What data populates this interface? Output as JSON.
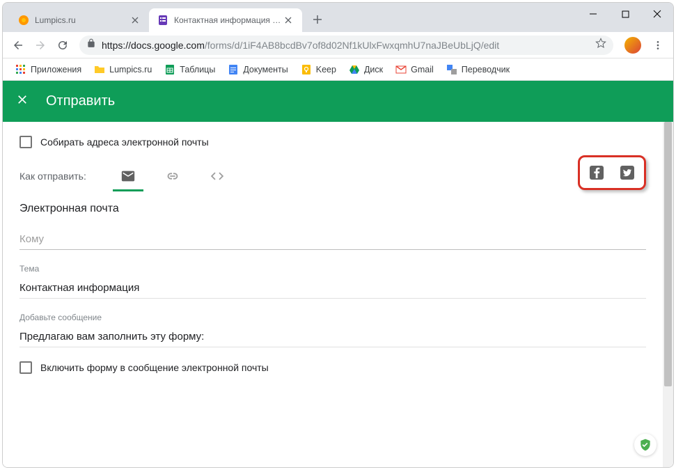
{
  "window": {
    "tabs": [
      {
        "title": "Lumpics.ru",
        "favicon": "orange"
      },
      {
        "title": "Контактная информация - Goo",
        "favicon": "forms"
      }
    ],
    "url_host": "https://docs.google.com",
    "url_path": "/forms/d/1iF4AB8bcdBv7of8d02Nf1kUlxFwxqmhU7naJBeUbLjQ/edit"
  },
  "bookmarks": [
    {
      "label": "Приложения",
      "icon": "apps"
    },
    {
      "label": "Lumpics.ru",
      "icon": "yellow"
    },
    {
      "label": "Таблицы",
      "icon": "sheets"
    },
    {
      "label": "Документы",
      "icon": "docs"
    },
    {
      "label": "Keep",
      "icon": "keep"
    },
    {
      "label": "Диск",
      "icon": "drive"
    },
    {
      "label": "Gmail",
      "icon": "gmail"
    },
    {
      "label": "Переводчик",
      "icon": "translate"
    }
  ],
  "dialog": {
    "title": "Отправить",
    "collect_emails": "Собирать адреса электронной почты",
    "send_via": "Как отправить:",
    "section_email": "Электронная почта",
    "to_placeholder": "Кому",
    "subject_label": "Тема",
    "subject_value": "Контактная информация",
    "message_label": "Добавьте сообщение",
    "message_value": "Предлагаю вам заполнить эту форму:",
    "include_form": "Включить форму в сообщение электронной почты",
    "social": {
      "facebook": "facebook",
      "twitter": "twitter"
    }
  }
}
